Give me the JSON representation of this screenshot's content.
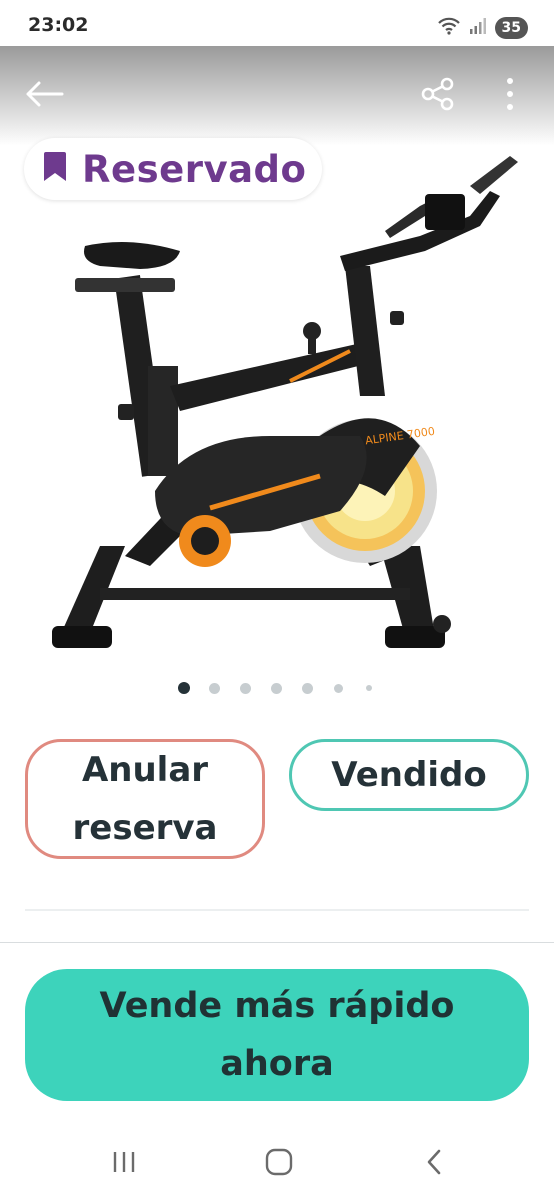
{
  "status_bar": {
    "time": "23:02",
    "battery": "35"
  },
  "product": {
    "status_badge": "Reservado",
    "image_icon": "exercise-bike",
    "image_count": 7,
    "current_image": 1
  },
  "actions": {
    "cancel_reservation_label": "Anular reserva",
    "sold_label": "Vendido"
  },
  "cta": {
    "label": "Vende más rápido ahora"
  },
  "colors": {
    "badge_text": "#6e3a8e",
    "cancel_border": "#e08a80",
    "sold_border": "#4fc7b3",
    "cta_background": "#3dd3bb",
    "bike_accent": "#f08a1c"
  }
}
